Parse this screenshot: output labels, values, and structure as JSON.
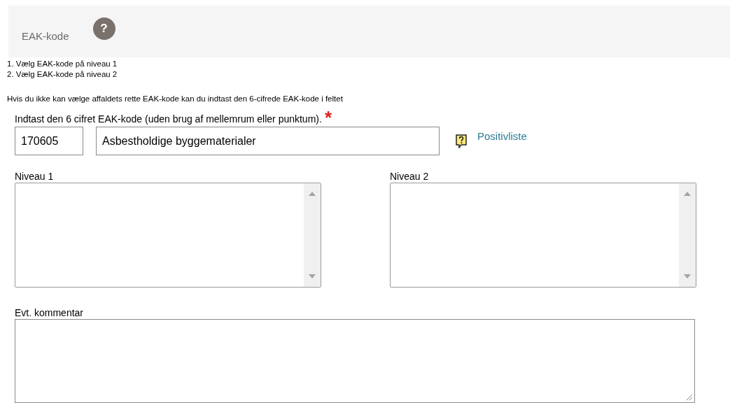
{
  "header": {
    "title": "EAK-kode",
    "help_icon": "?"
  },
  "steps": [
    "1. Vælg EAK-kode på niveau 1",
    "2. Vælg EAK-kode på niveau 2"
  ],
  "hint": "Hvis du ikke kan vælge affaldets rette EAK-kode kan du indtast den 6-cifrede EAK-kode i feltet",
  "code_entry": {
    "label": "Indtast den 6 cifret EAK-kode (uden brug af mellemrum eller punktum).",
    "required_mark": "*",
    "code_value": "170605",
    "name_value": "Asbestholdige byggematerialer",
    "link": "Positivliste"
  },
  "levels": [
    {
      "label": "Niveau 1"
    },
    {
      "label": "Niveau 2"
    }
  ],
  "comment": {
    "label": "Evt. kommentar"
  }
}
